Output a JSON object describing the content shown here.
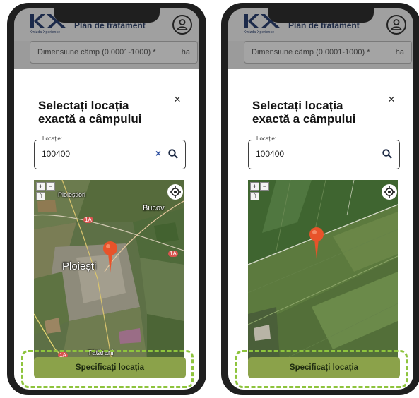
{
  "logo": {
    "sub": "Kwizda Xperience"
  },
  "app": {
    "title": "Plan de tratament"
  },
  "field_behind": {
    "label": "Dimensiune câmp (0.0001-1000) *",
    "unit": "ha"
  },
  "sheet": {
    "title": "Selectați locația exactă a câmpului",
    "close": "×",
    "location_label": "Locație:",
    "location_value": "100400",
    "clear": "×",
    "confirm_label": "Specificați locația"
  },
  "map_controls": {
    "zoom_in": "+",
    "zoom_out": "−",
    "rotate": "⇧"
  },
  "map_left": {
    "labels": {
      "ploiestiori": "Ploieștiori",
      "bucov": "Bucov",
      "ploiesti": "Ploiești",
      "tatarani": "Tătărani",
      "road_1a_a": "1A",
      "road_1a_b": "1A",
      "road_1a_c": "1A"
    }
  },
  "colors": {
    "accent": "#8ba24a",
    "highlight": "#8ec43d",
    "pin": "#e8532a"
  },
  "icons": [
    "kx-logo",
    "profile-icon",
    "close-icon",
    "clear-icon",
    "search-icon",
    "locate-icon",
    "map-pin-icon"
  ]
}
